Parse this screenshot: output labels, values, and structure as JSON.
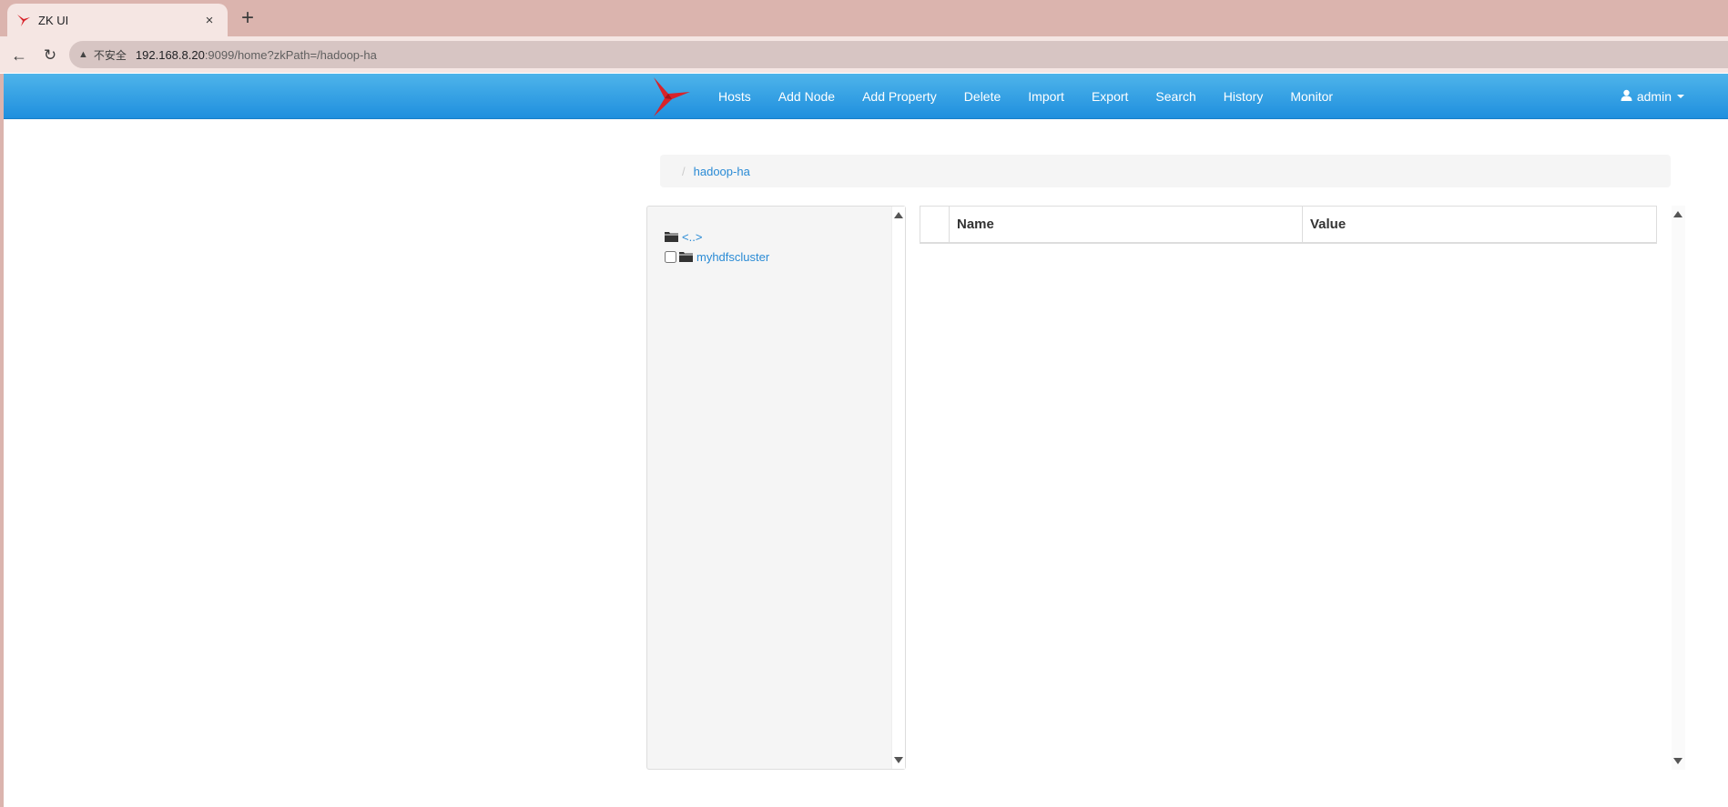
{
  "browser": {
    "tab_title": "ZK UI",
    "tab_close": "×",
    "new_tab": "+",
    "back": "←",
    "reload": "↻",
    "warning_icon": "▲",
    "insecure_label": "不安全",
    "url_host": "192.168.8.20",
    "url_path": ":9099/home?zkPath=/hadoop-ha"
  },
  "navbar": {
    "brand_icon": "bird-logo-icon",
    "brand_color": "#d8232a",
    "items": [
      {
        "label": "Hosts"
      },
      {
        "label": "Add Node"
      },
      {
        "label": "Add Property"
      },
      {
        "label": "Delete"
      },
      {
        "label": "Import"
      },
      {
        "label": "Export"
      },
      {
        "label": "Search"
      },
      {
        "label": "History"
      },
      {
        "label": "Monitor"
      }
    ],
    "user": {
      "icon": "user-icon",
      "name": "admin"
    },
    "gradient_top": "#4eb4ea",
    "gradient_bottom": "#1f8fde"
  },
  "breadcrumb": {
    "separator": "/",
    "items": [
      {
        "label": "hadoop-ha"
      }
    ]
  },
  "tree": {
    "items": [
      {
        "label": "<..>",
        "has_checkbox": false,
        "icon": "folder-icon"
      },
      {
        "label": "myhdfscluster",
        "has_checkbox": true,
        "icon": "folder-icon"
      }
    ]
  },
  "properties": {
    "columns": {
      "name": "Name",
      "value": "Value"
    },
    "rows": []
  },
  "colors": {
    "link": "#2a8bd5",
    "browser_frame": "#dbb4ae"
  }
}
